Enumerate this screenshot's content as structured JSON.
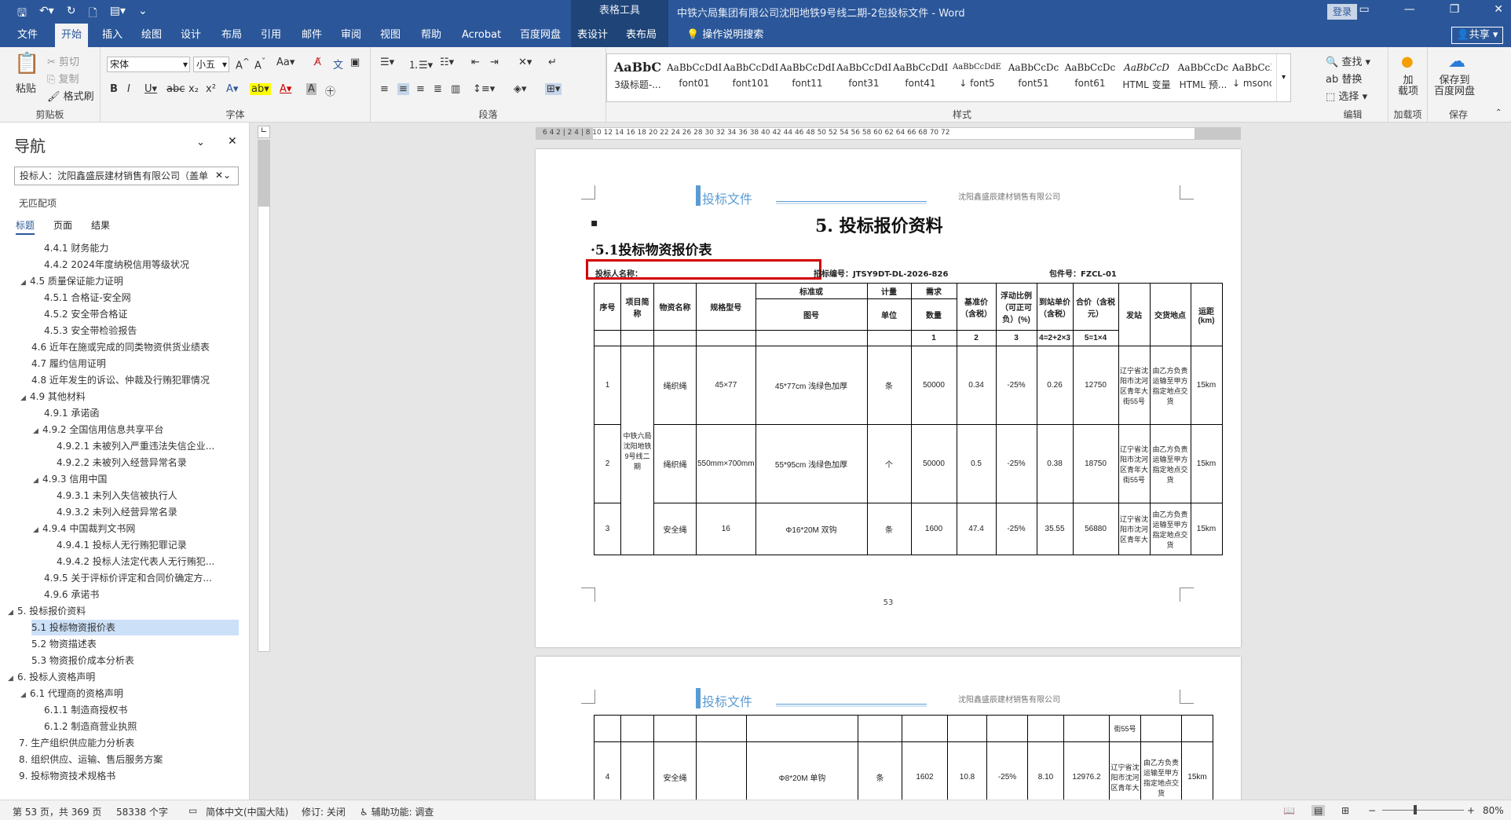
{
  "titlebar": {
    "context_tools": "表格工具",
    "document_title": "中铁六局集团有限公司沈阳地铁9号线二期-2包投标文件 - Word",
    "login": "登录"
  },
  "tabs": [
    "文件",
    "开始",
    "插入",
    "绘图",
    "设计",
    "布局",
    "引用",
    "邮件",
    "审阅",
    "视图",
    "帮助",
    "Acrobat",
    "百度网盘",
    "表设计",
    "表布局"
  ],
  "tell_me": "操作说明搜索",
  "share": "共享",
  "ribbon": {
    "clipboard": {
      "paste": "粘贴",
      "cut": "剪切",
      "copy": "复制",
      "format_painter": "格式刷",
      "label": "剪贴板"
    },
    "font": {
      "name": "宋体",
      "size": "小五",
      "label": "字体"
    },
    "paragraph": {
      "label": "段落"
    },
    "styles": {
      "label": "样式",
      "items": [
        {
          "preview": "AaBbC",
          "name": "3级标题-..."
        },
        {
          "preview": "AaBbCcDdI",
          "name": "font01"
        },
        {
          "preview": "AaBbCcDdI",
          "name": "font101"
        },
        {
          "preview": "AaBbCcDdI",
          "name": "font11"
        },
        {
          "preview": "AaBbCcDdI",
          "name": "font31"
        },
        {
          "preview": "AaBbCcDdI",
          "name": "font41"
        },
        {
          "preview": "AaBbCcDdE",
          "name": "↓ font5"
        },
        {
          "preview": "AaBbCcDc",
          "name": "font51"
        },
        {
          "preview": "AaBbCcDc",
          "name": "font61"
        },
        {
          "preview": "AaBbCcD",
          "name": "HTML 变量"
        },
        {
          "preview": "AaBbCcDc",
          "name": "HTML 预..."
        },
        {
          "preview": "AaBbCcDc",
          "name": "↓ msono..."
        }
      ]
    },
    "editing": {
      "find": "查找",
      "replace": "替换",
      "select": "选择",
      "label": "编辑"
    },
    "addins": {
      "addin": "加\n载项",
      "label": "加载项"
    },
    "save": {
      "save_to": "保存到\n百度网盘",
      "label": "保存"
    }
  },
  "nav": {
    "title": "导航",
    "search_value": "投标人：沈阳鑫盛辰建材销售有限公司（盖单",
    "no_match": "无匹配项",
    "tabs": [
      "标题",
      "页面",
      "结果"
    ],
    "items": [
      {
        "text": "4.4.1 财务能力",
        "level": 3
      },
      {
        "text": "4.4.2 2024年度纳税信用等级状况",
        "level": 3
      },
      {
        "text": "4.5 质量保证能力证明",
        "level": 2,
        "caret": true
      },
      {
        "text": "4.5.1 合格证-安全网",
        "level": 3
      },
      {
        "text": "4.5.2 安全带合格证",
        "level": 3
      },
      {
        "text": "4.5.3 安全带检验报告",
        "level": 3
      },
      {
        "text": "4.6 近年在施或完成的同类物资供货业绩表",
        "level": 2
      },
      {
        "text": "4.7 履约信用证明",
        "level": 2
      },
      {
        "text": "4.8 近年发生的诉讼、仲裁及行贿犯罪情况",
        "level": 2
      },
      {
        "text": "4.9 其他材料",
        "level": 2,
        "caret": true
      },
      {
        "text": "4.9.1 承诺函",
        "level": 3
      },
      {
        "text": "4.9.2 全国信用信息共享平台",
        "level": 3,
        "caret": true
      },
      {
        "text": "4.9.2.1 未被列入严重违法失信企业...",
        "level": 4
      },
      {
        "text": "4.9.2.2 未被列入经营异常名录",
        "level": 4
      },
      {
        "text": "4.9.3 信用中国",
        "level": 3,
        "caret": true
      },
      {
        "text": "4.9.3.1 未列入失信被执行人",
        "level": 4
      },
      {
        "text": "4.9.3.2 未列入经营异常名录",
        "level": 4
      },
      {
        "text": "4.9.4 中国裁判文书网",
        "level": 3,
        "caret": true
      },
      {
        "text": "4.9.4.1 投标人无行贿犯罪记录",
        "level": 4
      },
      {
        "text": "4.9.4.2 投标人法定代表人无行贿犯...",
        "level": 4
      },
      {
        "text": "4.9.5 关于评标价评定和合同价确定方...",
        "level": 3
      },
      {
        "text": "4.9.6 承诺书",
        "level": 3
      },
      {
        "text": "5. 投标报价资料",
        "level": 1,
        "caret": true
      },
      {
        "text": "5.1 投标物资报价表",
        "level": 2,
        "selected": true
      },
      {
        "text": "5.2 物资描述表",
        "level": 2
      },
      {
        "text": "5.3 物资报价成本分析表",
        "level": 2
      },
      {
        "text": "6. 投标人资格声明",
        "level": 1,
        "caret": true
      },
      {
        "text": "6.1 代理商的资格声明",
        "level": 2,
        "caret": true
      },
      {
        "text": "6.1.1 制造商授权书",
        "level": 3
      },
      {
        "text": "6.1.2 制造商营业执照",
        "level": 3
      },
      {
        "text": "7. 生产组织供应能力分析表",
        "level": 1
      },
      {
        "text": "8. 组织供应、运输、售后服务方案",
        "level": 1
      },
      {
        "text": "9. 投标物资技术规格书",
        "level": 1
      }
    ]
  },
  "ruler": {
    "ticks": "6 4 2 | 2 4 | 8 10 12 14 16 18 20 22 24 26 28 30 32 34 36 38 40 42 44 46 48 50 52 54 56 58 60 62 64 66 68 70 72"
  },
  "doc": {
    "header_brand": "投标文件",
    "header_company": "沈阳鑫盛辰建材销售有限公司",
    "h1": "5.    投标报价资料",
    "h2": "·5.1投标物资报价表",
    "bidder_label": "投标人名称：",
    "bid_no": "招标编号：JTSY9DT-DL-2026-826",
    "package": "包件号：FZCL-01",
    "table": {
      "headers": {
        "seq": "序号",
        "project": "项目简称",
        "material": "物资名称",
        "spec": "规格型号",
        "standard": "标准或",
        "drawing": "图号",
        "unit_top": "计量",
        "unit": "单位",
        "qty_top": "需求",
        "qty": "数量",
        "base_price": "基准价（含税）",
        "float": "浮动比例（可正可负）(%)",
        "arrival": "到站单价（含税）",
        "total": "合价（含税元）",
        "station": "发站",
        "place": "交货地点",
        "distance": "运距(km)"
      },
      "formula": {
        "qty": "1",
        "base": "2",
        "float": "3",
        "arrival": "4=2+2×3",
        "total": "5=1×4"
      },
      "project_name": "中铁六局沈阳地铁9号线二期",
      "rows": [
        {
          "seq": "1",
          "material": "绳织绳",
          "spec": "45×77",
          "drawing": "45*77cm 浅绿色加厚",
          "unit": "条",
          "qty": "50000",
          "base": "0.34",
          "float": "-25%",
          "arrival": "0.26",
          "total": "12750",
          "station": "辽宁省沈阳市沈河区青年大街55号",
          "place": "由乙方负责运输至甲方指定地点交货",
          "distance": "15km"
        },
        {
          "seq": "2",
          "material": "绳织绳",
          "spec": "550mm×700mm",
          "drawing": "55*95cm 浅绿色加厚",
          "unit": "个",
          "qty": "50000",
          "base": "0.5",
          "float": "-25%",
          "arrival": "0.38",
          "total": "18750",
          "station": "辽宁省沈阳市沈河区青年大街55号",
          "place": "由乙方负责运输至甲方指定地点交货",
          "distance": "15km"
        },
        {
          "seq": "3",
          "material": "安全绳",
          "spec": "16",
          "drawing": "Φ16*20M 双钩",
          "unit": "条",
          "qty": "1600",
          "base": "47.4",
          "float": "-25%",
          "arrival": "35.55",
          "total": "56880",
          "station": "辽宁省沈阳市沈河区青年大",
          "place": "由乙方负责运输至甲方指定地点交货",
          "distance": "15km"
        }
      ],
      "row4": {
        "seq": "4",
        "material": "安全绳",
        "spec": "",
        "drawing": "Φ8*20M 单钩",
        "unit": "条",
        "qty": "1602",
        "base": "10.8",
        "float": "-25%",
        "arrival": "8.10",
        "total": "12976.2",
        "station": "辽宁省沈阳市沈河区青年大",
        "place": "由乙方负责运输至甲方指定地点交货",
        "distance": "15km"
      },
      "row4_prev_station": "街55号"
    },
    "page_number": "53"
  },
  "status": {
    "page": "第 53 页，共 369 页",
    "words": "58338 个字",
    "lang": "简体中文(中国大陆)",
    "track": "修订: 关闭",
    "access": "辅助功能: 调查",
    "zoom": "80%"
  }
}
